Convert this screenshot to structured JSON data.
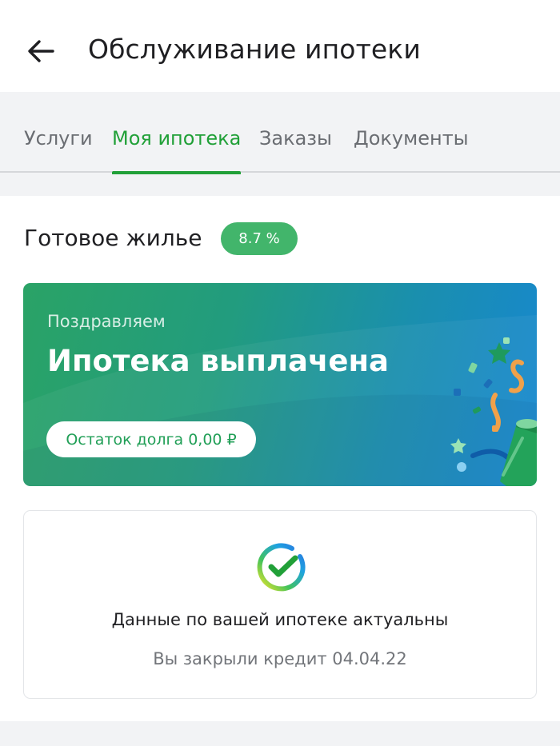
{
  "header": {
    "title": "Обслуживание ипотеки",
    "back_icon": "arrow-left-icon"
  },
  "tabs": [
    {
      "label": "Услуги",
      "active": false
    },
    {
      "label": "Моя ипотека",
      "active": true
    },
    {
      "label": "Заказы",
      "active": false
    },
    {
      "label": "Документы",
      "active": false
    }
  ],
  "mortgage": {
    "product_name": "Готовое жилье",
    "rate": "8.7 %"
  },
  "promo": {
    "subtitle": "Поздравляем",
    "title": "Ипотека выплачена",
    "debt_label": "Остаток долга 0,00 ₽",
    "illustration_icon": "party-popper-icon"
  },
  "status": {
    "icon": "sber-check-icon",
    "title": "Данные по вашей ипотеке актуальны",
    "subtitle": "Вы закрыли кредит 04.04.22"
  },
  "colors": {
    "accent": "#21a038",
    "badge": "#42b56b",
    "card_gradient_start": "#2aa366",
    "card_gradient_end": "#1787d1"
  }
}
